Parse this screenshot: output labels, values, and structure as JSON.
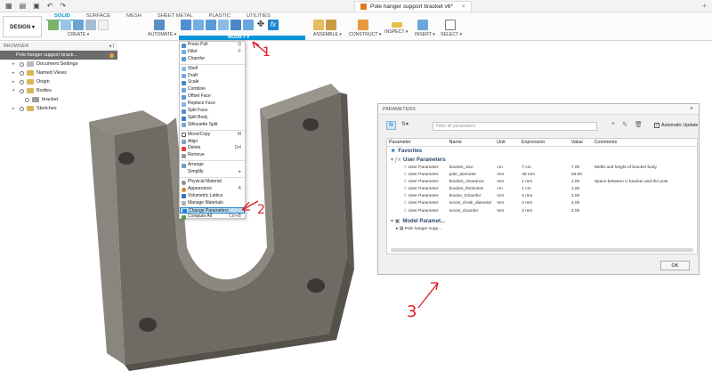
{
  "document": {
    "tab_title": "Pole hanger support bracket v6*",
    "close_glyph": "×"
  },
  "ribbon": {
    "workspace": "DESIGN ▾",
    "tabs": [
      "SOLID",
      "SURFACE",
      "MESH",
      "SHEET METAL",
      "PLASTIC",
      "UTILITIES"
    ],
    "active_tab": "SOLID",
    "groups": {
      "create": "CREATE ▾",
      "automate": "AUTOMATE ▾",
      "modify": "MODIFY ▾",
      "assemble": "ASSEMBLE ▾",
      "construct": "CONSTRUCT ▾",
      "inspect": "INSPECT ▾",
      "insert": "INSERT ▾",
      "select": "SELECT ▾"
    }
  },
  "browser": {
    "header": "BROWSER",
    "root": "Pole hanger support brack...",
    "items": [
      "Document Settings",
      "Named Views",
      "Origin",
      "Bodies",
      "bracket",
      "Sketches"
    ]
  },
  "modify_menu": {
    "items": [
      {
        "label": "Press Pull",
        "shortcut": "Q"
      },
      {
        "label": "Fillet",
        "shortcut": "F"
      },
      {
        "label": "Chamfer",
        "shortcut": ""
      },
      {
        "label": "Shell",
        "shortcut": ""
      },
      {
        "label": "Draft",
        "shortcut": ""
      },
      {
        "label": "Scale",
        "shortcut": ""
      },
      {
        "label": "Combine",
        "shortcut": ""
      },
      {
        "label": "Offset Face",
        "shortcut": ""
      },
      {
        "label": "Replace Face",
        "shortcut": ""
      },
      {
        "label": "Split Face",
        "shortcut": ""
      },
      {
        "label": "Split Body",
        "shortcut": ""
      },
      {
        "label": "Silhouette Split",
        "shortcut": ""
      },
      {
        "label": "Move/Copy",
        "shortcut": "M"
      },
      {
        "label": "Align",
        "shortcut": ""
      },
      {
        "label": "Delete",
        "shortcut": "Del"
      },
      {
        "label": "Remove",
        "shortcut": ""
      },
      {
        "label": "Arrange",
        "shortcut": ""
      },
      {
        "label": "Simplify",
        "shortcut": "▸"
      },
      {
        "label": "Physical Material",
        "shortcut": ""
      },
      {
        "label": "Appearance",
        "shortcut": "A"
      },
      {
        "label": "Volumetric Lattice",
        "shortcut": ""
      },
      {
        "label": "Manage Materials",
        "shortcut": ""
      },
      {
        "label": "Change Parameters",
        "shortcut": "⋮"
      },
      {
        "label": "Compute All",
        "shortcut": "Ctrl+B"
      }
    ],
    "highlighted": "Change Parameters"
  },
  "annotations": [
    "1",
    "2",
    "3"
  ],
  "parameters": {
    "title": "PARAMETERS",
    "filter_placeholder": "Filter all parameters",
    "auto_update_label": "Automatic Update",
    "auto_update_checked": true,
    "columns": [
      "Parameter",
      "Name",
      "Unit",
      "Expression",
      "Value",
      "Comments"
    ],
    "favorites_label": "Favorites",
    "user_params_label": "User Parameters",
    "rows": [
      {
        "type": "User Parameter",
        "name": "bracket_size",
        "unit": "cm",
        "expr": "7 cm",
        "value": "7.00",
        "comment": "Width and height of bracket body"
      },
      {
        "type": "User Parameter",
        "name": "pole_diameter",
        "unit": "mm",
        "expr": "28 mm",
        "value": "28.00",
        "comment": ""
      },
      {
        "type": "User Parameter",
        "name": "bracket_clearance",
        "unit": "mm",
        "expr": "1 mm",
        "value": "1.00",
        "comment": "Space between U bracket and the pole"
      },
      {
        "type": "User Parameter",
        "name": "bracket_thickness",
        "unit": "cm",
        "expr": "1 cm",
        "value": "1.00",
        "comment": ""
      },
      {
        "type": "User Parameter",
        "name": "bracke_tchamfer",
        "unit": "mm",
        "expr": "2 mm",
        "value": "2.00",
        "comment": ""
      },
      {
        "type": "User Parameter",
        "name": "screw_chole_diameter",
        "unit": "mm",
        "expr": "4 mm",
        "value": "4.00",
        "comment": ""
      },
      {
        "type": "User Parameter",
        "name": "screw_chamfer",
        "unit": "mm",
        "expr": "2 mm",
        "value": "2.00",
        "comment": ""
      }
    ],
    "model_params_label": "Model Paramet...",
    "model_item": "Pole hanger supp...",
    "ok_label": "OK"
  },
  "colors": {
    "accent": "#0696d7",
    "annotation": "#e11b24",
    "menu_highlight": "#bfe0f3",
    "body": "#7b766f"
  }
}
